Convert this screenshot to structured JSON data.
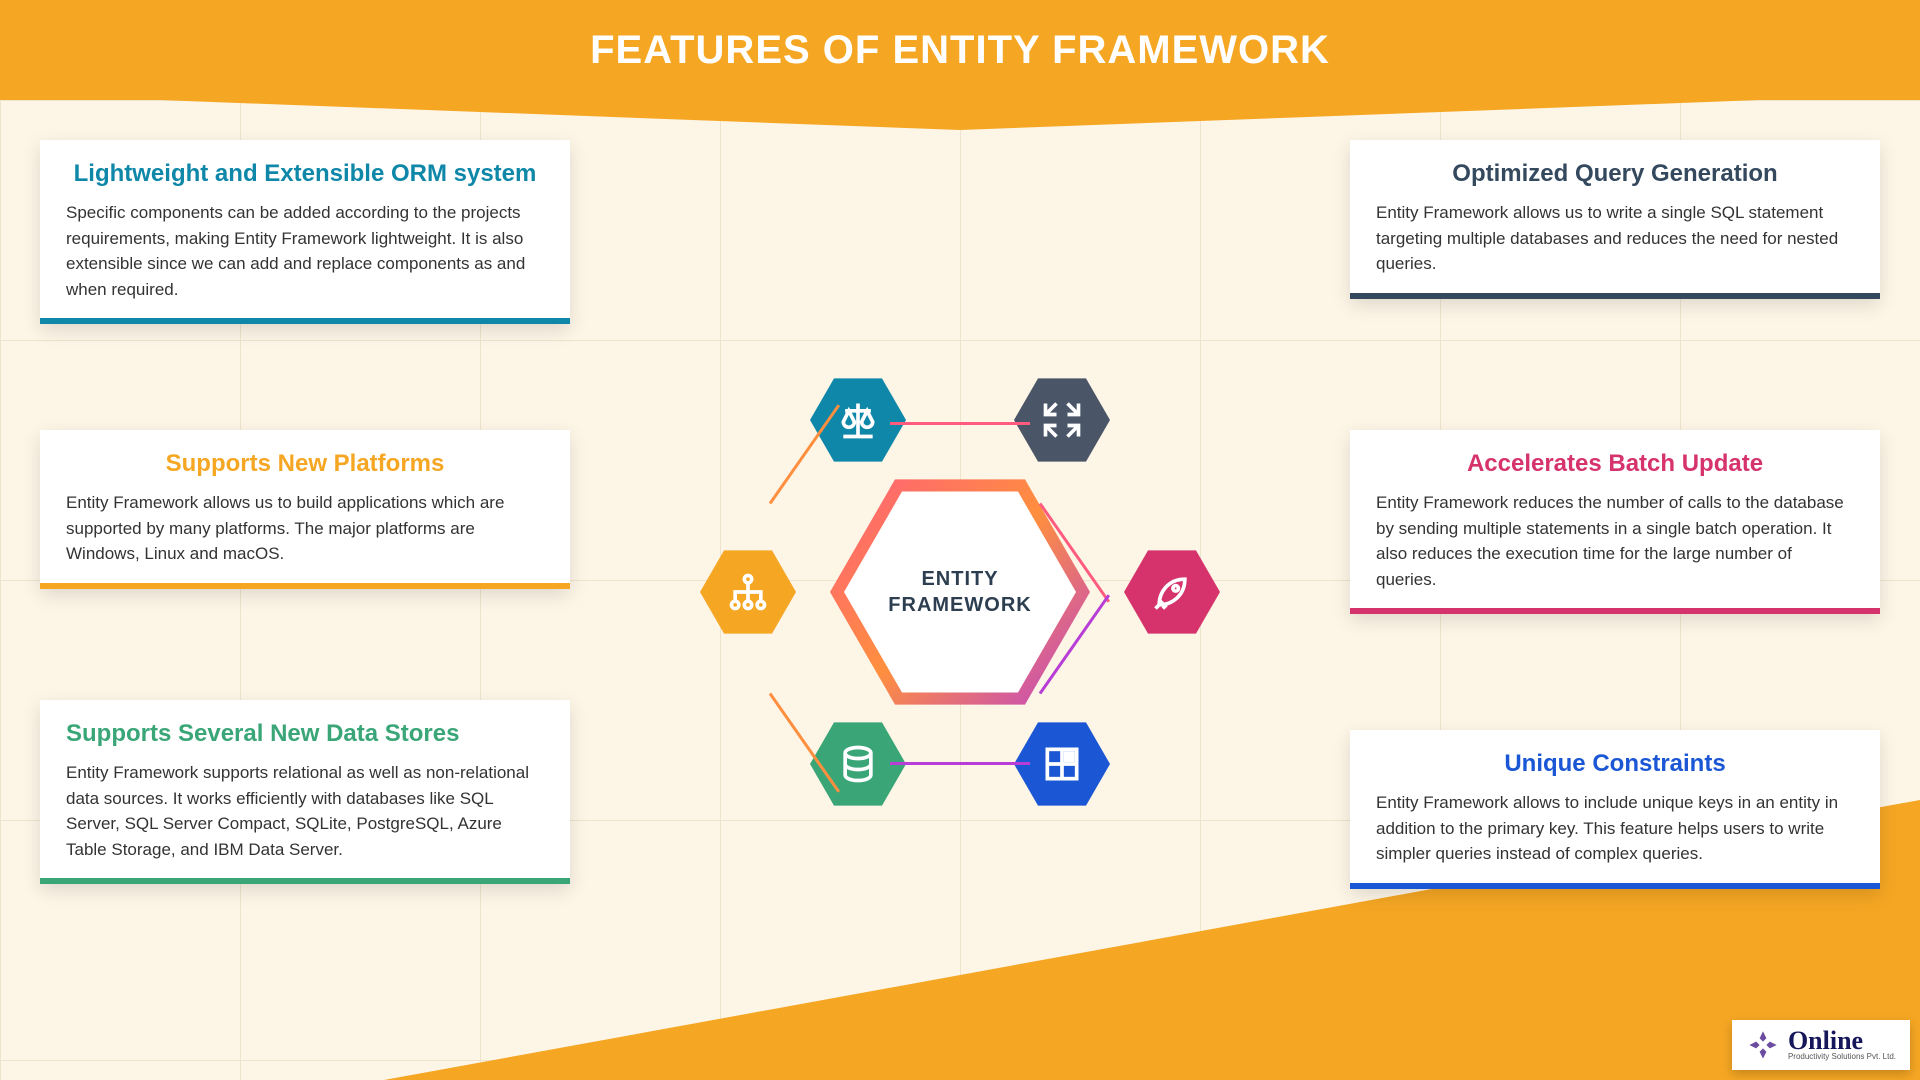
{
  "header": {
    "title": "FEATURES OF ENTITY FRAMEWORK"
  },
  "center": {
    "line1": "ENTITY",
    "line2": "FRAMEWORK"
  },
  "cards": {
    "left1": {
      "title": "Lightweight and Extensible ORM system",
      "body": "Specific components can be added according to the projects requirements, making Entity Framework lightweight. It is also extensible since we can add and replace components as and when required."
    },
    "left2": {
      "title": "Supports New Platforms",
      "body": "Entity Framework allows us to build applications which are supported by many platforms. The major platforms are Windows, Linux and macOS."
    },
    "left3": {
      "title": "Supports Several New Data Stores",
      "body": "Entity Framework supports relational as well as non-relational data sources. It works efficiently with databases like SQL Server, SQL Server Compact, SQLite, PostgreSQL, Azure Table Storage, and IBM Data Server."
    },
    "right1": {
      "title": "Optimized Query Generation",
      "body": "Entity Framework allows us to write a single SQL statement targeting multiple databases and reduces the need for nested queries."
    },
    "right2": {
      "title": "Accelerates Batch Update",
      "body": "Entity Framework reduces the number of calls to the database by sending multiple statements in a single batch operation. It also reduces the execution time for the large number of queries."
    },
    "right3": {
      "title": "Unique Constraints",
      "body": "Entity Framework allows to include unique keys in an entity in addition to the primary key. This feature helps users to write simpler queries instead of complex queries."
    }
  },
  "logo": {
    "name": "Online",
    "sub": "Productivity Solutions Pvt. Ltd."
  },
  "icons": {
    "tl": "scales-icon",
    "tr": "contract-arrows-icon",
    "l": "hierarchy-icon",
    "r": "rocket-icon",
    "bl": "database-icon",
    "br": "table-grid-icon"
  }
}
